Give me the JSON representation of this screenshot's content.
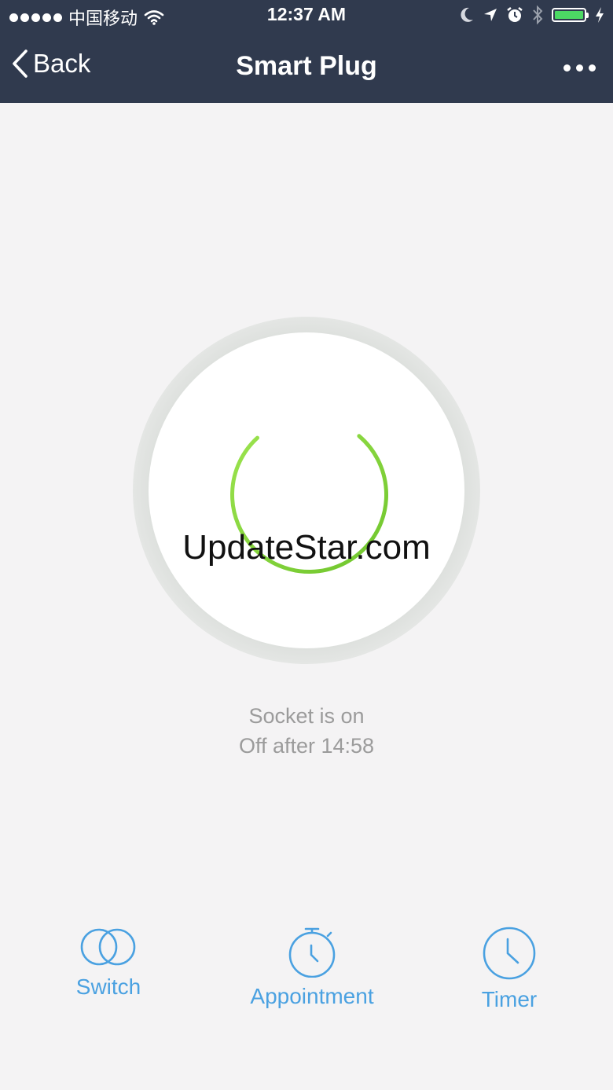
{
  "status_bar": {
    "carrier": "中国移动",
    "time": "12:37 AM",
    "icons": [
      "signal-dots-icon",
      "wifi-icon",
      "moon-icon",
      "location-arrow-icon",
      "alarm-icon",
      "bluetooth-icon",
      "battery-icon",
      "charging-bolt-icon"
    ],
    "battery_level": 1.0,
    "battery_color": "#4cd964"
  },
  "nav": {
    "back_label": "Back",
    "title": "Smart Plug",
    "more_icon": "more-dots-icon"
  },
  "power": {
    "icon": "power-icon",
    "color": "#86d43a"
  },
  "watermark": "UpdateStar.com",
  "socket": {
    "status": "Socket is on",
    "off_after": "Off after 14:58"
  },
  "bottom_nav": {
    "switch_label": "Switch",
    "appointment_label": "Appointment",
    "timer_label": "Timer",
    "accent": "#4aa1e1"
  }
}
